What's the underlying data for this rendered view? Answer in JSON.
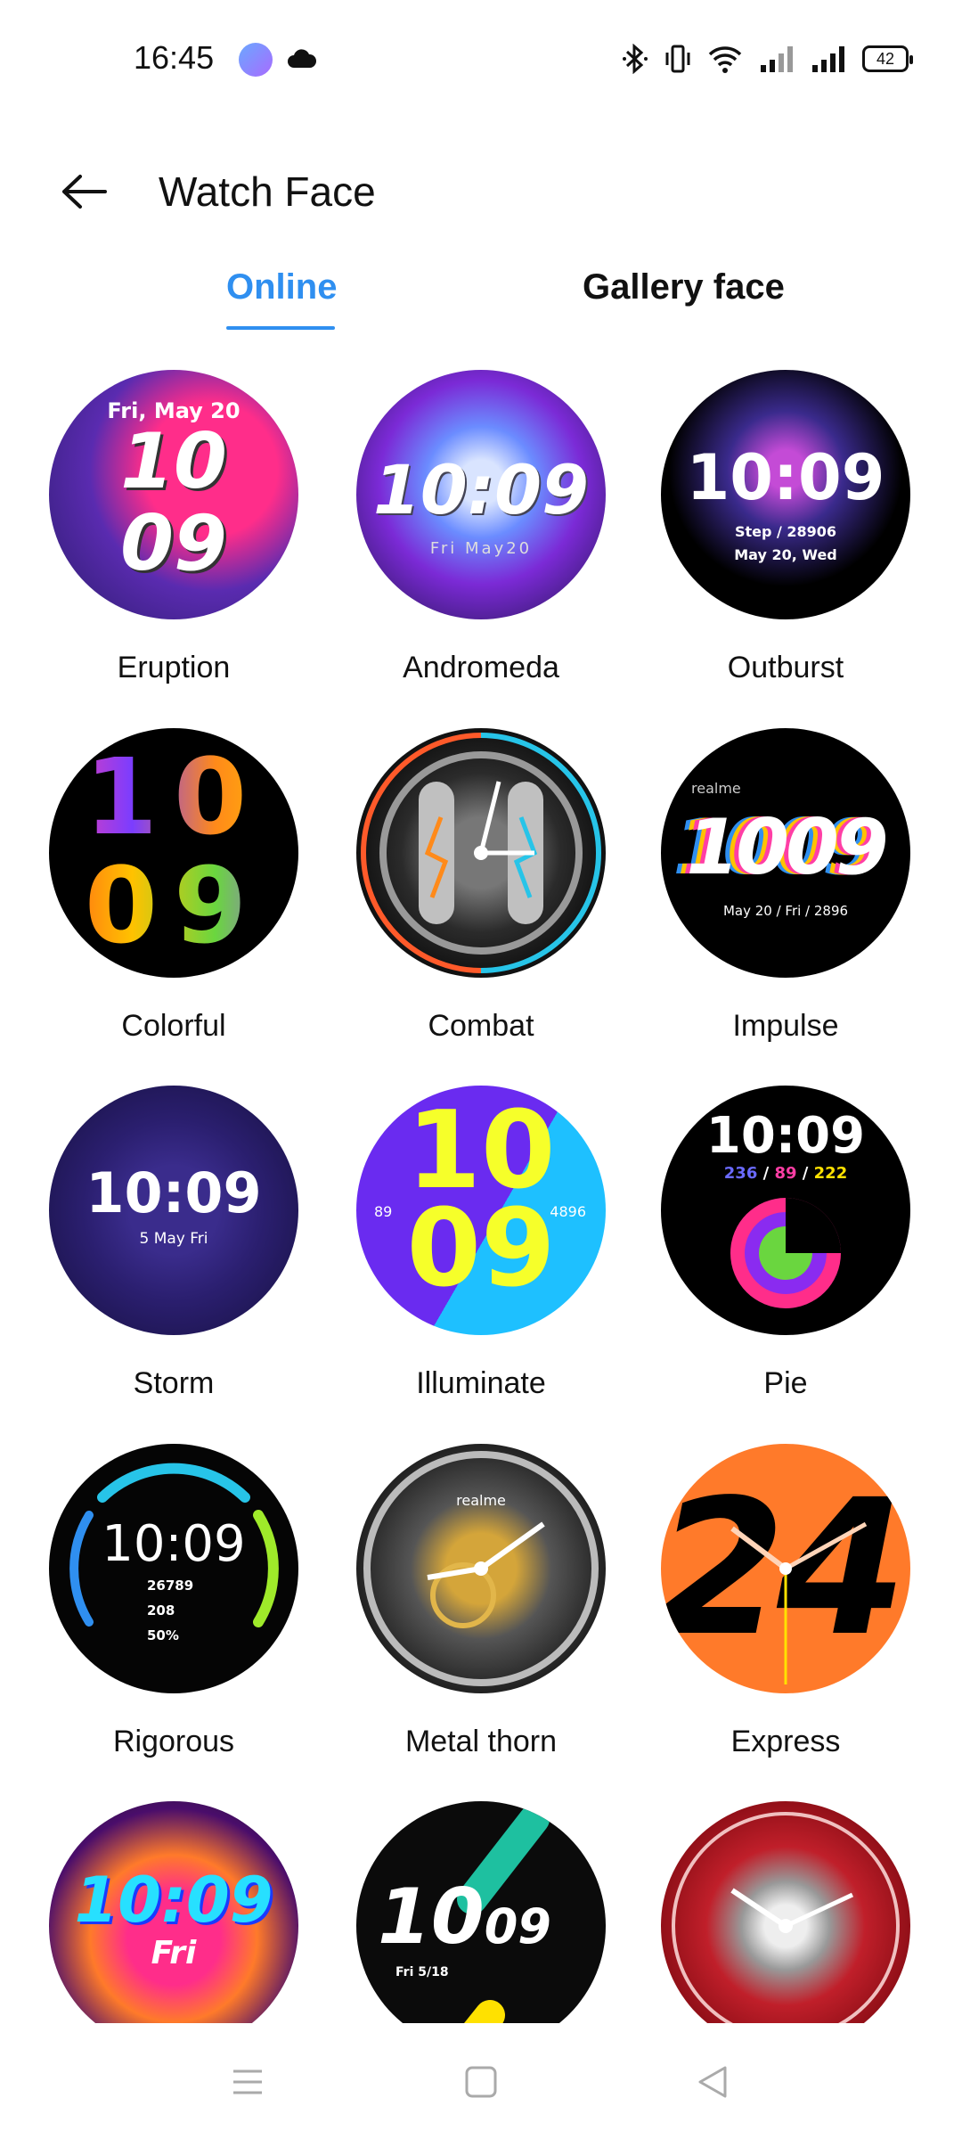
{
  "status_bar": {
    "time": "16:45",
    "battery": "42",
    "icons": [
      "app-badge-icon",
      "cloud-icon",
      "bluetooth-icon",
      "vibrate-icon",
      "wifi-icon",
      "signal-icon",
      "signal-icon",
      "battery-icon"
    ]
  },
  "app_bar": {
    "title": "Watch Face",
    "back_icon": "arrow-left-icon"
  },
  "tabs": {
    "online": "Online",
    "gallery": "Gallery face",
    "active": "Online",
    "accent_color": "#2f8ff0"
  },
  "faces": [
    {
      "name": "Eruption",
      "date": "Fri, May 20",
      "hour": "10",
      "minute": "09"
    },
    {
      "name": "Andromeda",
      "time": "10:09",
      "date": "Fri May20"
    },
    {
      "name": "Outburst",
      "time": "10:09",
      "step": "Step / 28906",
      "date": "May 20, Wed"
    },
    {
      "name": "Colorful",
      "hour": "10",
      "minute": "09"
    },
    {
      "name": "Combat"
    },
    {
      "name": "Impulse",
      "brand": "realme",
      "time": "1009",
      "info": "May 20  /  Fri  /  2896"
    },
    {
      "name": "Storm",
      "time": "10:09",
      "date": "5 May Fri"
    },
    {
      "name": "Illuminate",
      "hour": "10",
      "minute": "09",
      "left": "89",
      "right": "4896"
    },
    {
      "name": "Pie",
      "time": "10:09",
      "stats": [
        "236",
        "89",
        "222"
      ]
    },
    {
      "name": "Rigorous",
      "time": "10:09",
      "stats": [
        "26789",
        "208",
        "50%"
      ]
    },
    {
      "name": "Metal thorn",
      "brand": "realme"
    },
    {
      "name": "Express",
      "digits": "24"
    },
    {
      "time": "10:09",
      "day": "Fri"
    },
    {
      "hour": "10",
      "minute": "09",
      "date": "Fri  5/18"
    },
    {}
  ],
  "nav_bar": {
    "icons": [
      "menu-icon",
      "home-square-icon",
      "back-triangle-icon"
    ]
  }
}
